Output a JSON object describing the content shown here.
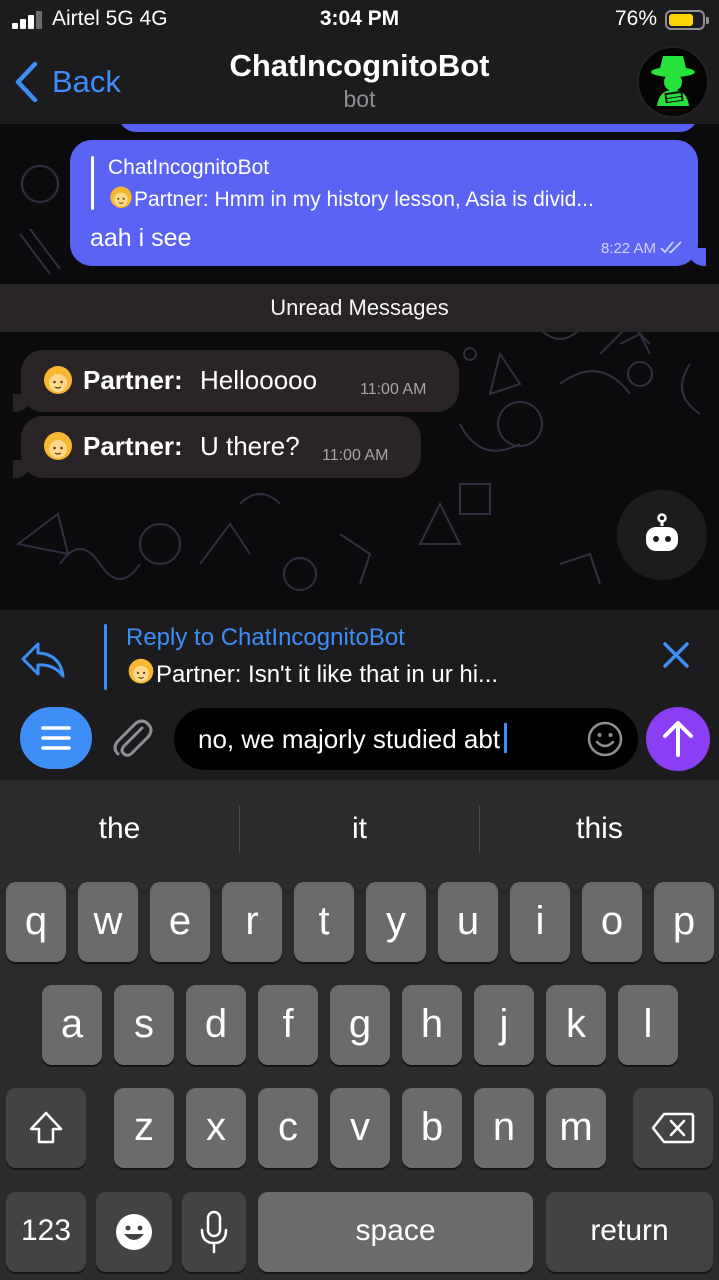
{
  "status_bar": {
    "carrier": "Airtel 5G  4G",
    "time": "3:04 PM",
    "battery_percent": "76%",
    "battery_level": 0.76,
    "battery_color": "#ffd60a"
  },
  "nav": {
    "back_label": "Back",
    "title": "ChatIncognitoBot",
    "subtitle": "bot",
    "accent_color": "#3e8ef7"
  },
  "outgoing_message": {
    "reply_to_name": "ChatIncognitoBot",
    "reply_to_text": "Partner: Hmm in my history lesson, Asia is divid...",
    "text": "aah i see",
    "time": "8:22 AM",
    "status_icon": "double-check-icon",
    "bubble_color": "#5b63f4"
  },
  "unread_label": "Unread Messages",
  "incoming_messages": [
    {
      "sender": "Partner:",
      "text": "Hellooooo",
      "time": "11:00 AM",
      "icon": "person-emoji-icon"
    },
    {
      "sender": "Partner:",
      "text": "U there?",
      "time": "11:00 AM",
      "icon": "person-emoji-icon"
    }
  ],
  "reply_panel": {
    "title": "Reply to ChatIncognitoBot",
    "preview": "Partner: Isn't it like that in ur hi..."
  },
  "composer": {
    "input_value": "no, we majorly studied abt",
    "send_color": "#8a3ff5"
  },
  "keyboard": {
    "suggestions": [
      "the",
      "it",
      "this"
    ],
    "row1": [
      "q",
      "w",
      "e",
      "r",
      "t",
      "y",
      "u",
      "i",
      "o",
      "p"
    ],
    "row2": [
      "a",
      "s",
      "d",
      "f",
      "g",
      "h",
      "j",
      "k",
      "l"
    ],
    "row3": [
      "z",
      "x",
      "c",
      "v",
      "b",
      "n",
      "m"
    ],
    "numbers_label": "123",
    "space_label": "space",
    "return_label": "return"
  }
}
